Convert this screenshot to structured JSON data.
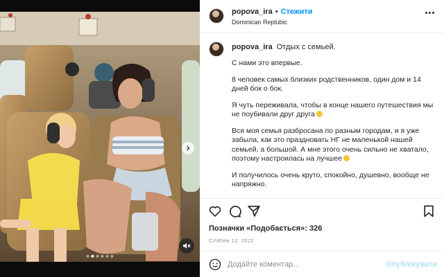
{
  "post": {
    "username": "popova_ira",
    "follow_label": "Стежити",
    "location": "Dominican Replubic",
    "caption_title": "Отдых с семьей.",
    "caption_paragraphs": [
      "С нами это впервые.",
      "8 человек самых близких родственников, один дом и 14 дней бок о бок.",
      "Я чуть переживала, чтобы в конце нашего путешествия мы не поубивали друг друга",
      "Вся моя семья разбросана по разным городам, и я уже забыла, как это праздновать НГ не маленькой нашей семьей, а большой. А мне этого очень сильно не хватало, поэтому настроилась на лучшее",
      "И получилось очень круто, спокойно, душевно, вообще не напряжно."
    ],
    "likes_text": "Позначки «Подобається»: 326",
    "date": "січень 12, 2022",
    "carousel": {
      "slides": 6,
      "active_index": 1
    }
  },
  "icons": {
    "more": "more-icon",
    "like": "heart-icon",
    "comment": "comment-icon",
    "share": "share-icon",
    "save": "bookmark-icon",
    "emoji": "smile-icon",
    "mute": "muted-speaker-icon",
    "next": "chevron-right-icon"
  },
  "comment": {
    "placeholder": "Додайте коментар...",
    "post_label": "Опублікувати"
  },
  "colors": {
    "accent": "#0095f6",
    "post_disabled": "#b2dffc",
    "muted_text": "#8e8e8e"
  }
}
